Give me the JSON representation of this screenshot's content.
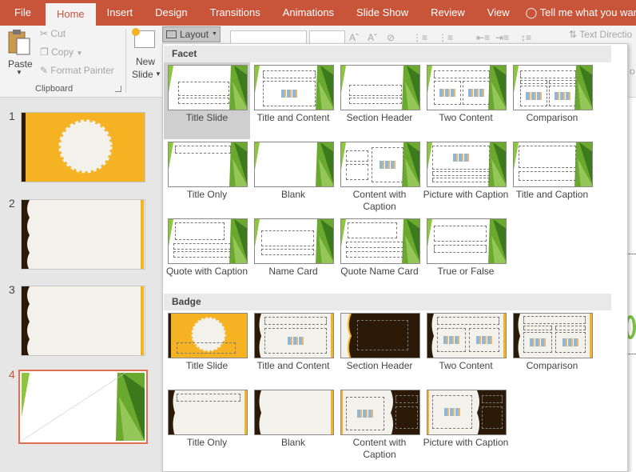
{
  "tabs": [
    "File",
    "Home",
    "Insert",
    "Design",
    "Transitions",
    "Animations",
    "Slide Show",
    "Review",
    "View"
  ],
  "tell_me": "Tell me what you want to",
  "clipboard": {
    "paste": "Paste",
    "cut": "Cut",
    "copy": "Copy",
    "format_painter": "Format Painter",
    "label": "Clipboard"
  },
  "new_slide": {
    "line1": "New",
    "line2": "Slide"
  },
  "layout_button": "Layout",
  "text_direction": "Text Directio",
  "partial_right": "o",
  "slide_numbers": [
    "1",
    "2",
    "3",
    "4"
  ],
  "sections": [
    {
      "name": "Facet",
      "layouts": [
        "Title Slide",
        "Title and Content",
        "Section Header",
        "Two Content",
        "Comparison",
        "Title Only",
        "Blank",
        "Content with Caption",
        "Picture with Caption",
        "Title and Caption",
        "Quote with Caption",
        "Name Card",
        "Quote Name Card",
        "True or False"
      ]
    },
    {
      "name": "Badge",
      "layouts": [
        "Title Slide",
        "Title and Content",
        "Section Header",
        "Two Content",
        "Comparison",
        "Title Only",
        "Blank",
        "Content with Caption",
        "Picture with Caption"
      ]
    }
  ],
  "selected_layout": "Title Slide",
  "colors": {
    "ribbon_accent": "#c8553a",
    "facet_green": "#6aa82e",
    "badge_gold": "#f5b324",
    "badge_dark": "#2c1a09"
  }
}
